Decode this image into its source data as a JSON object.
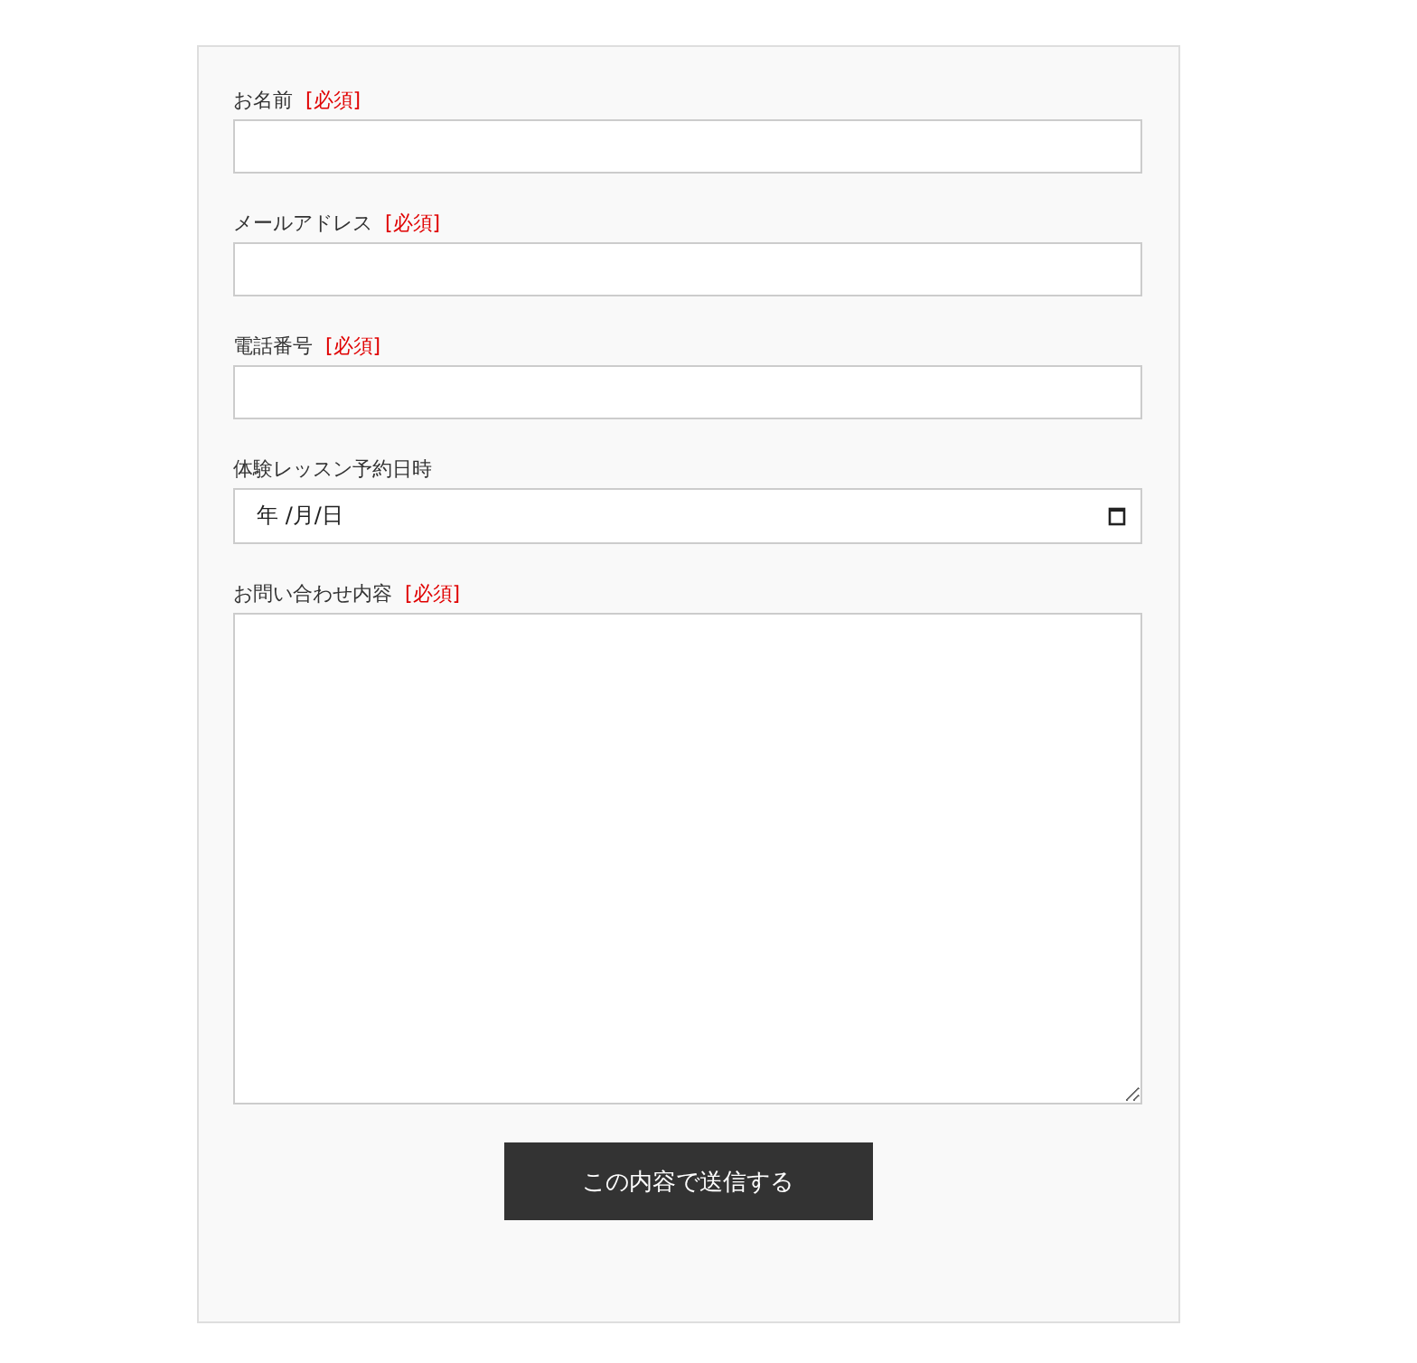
{
  "fields": [
    {
      "kind": "text",
      "label": "お名前",
      "required_mark": "[必須]"
    },
    {
      "kind": "text",
      "label": "メールアドレス",
      "required_mark": "[必須]"
    },
    {
      "kind": "text",
      "label": "電話番号",
      "required_mark": "[必須]"
    },
    {
      "kind": "date",
      "label": "体験レッスン予約日時",
      "placeholder": "年 /月/日"
    },
    {
      "kind": "textarea",
      "label": "お問い合わせ内容",
      "required_mark": "[必須]"
    }
  ],
  "submit_button": "この内容で送信する"
}
